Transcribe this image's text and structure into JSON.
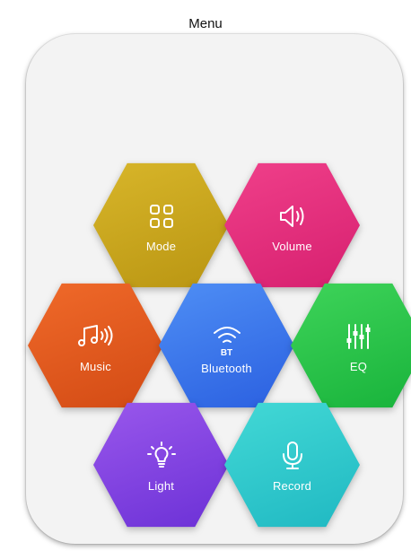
{
  "header": {
    "title": "Menu"
  },
  "menu": {
    "mode": {
      "label": "Mode",
      "color_top": "#d8b62a",
      "color_bottom": "#b99512"
    },
    "volume": {
      "label": "Volume",
      "color_top": "#f0408a",
      "color_bottom": "#d61f6f"
    },
    "music": {
      "label": "Music",
      "color_top": "#f06a2a",
      "color_bottom": "#d24a14"
    },
    "bluetooth": {
      "label": "Bluetooth",
      "icon_text": "BT",
      "color_top": "#4f8ff5",
      "color_bottom": "#2a5fe0"
    },
    "eq": {
      "label": "EQ",
      "color_top": "#3fd45a",
      "color_bottom": "#17b23a"
    },
    "light": {
      "label": "Light",
      "color_top": "#9a58ec",
      "color_bottom": "#6b30d6"
    },
    "record": {
      "label": "Record",
      "color_top": "#43d9d6",
      "color_bottom": "#1fb8c2"
    }
  }
}
